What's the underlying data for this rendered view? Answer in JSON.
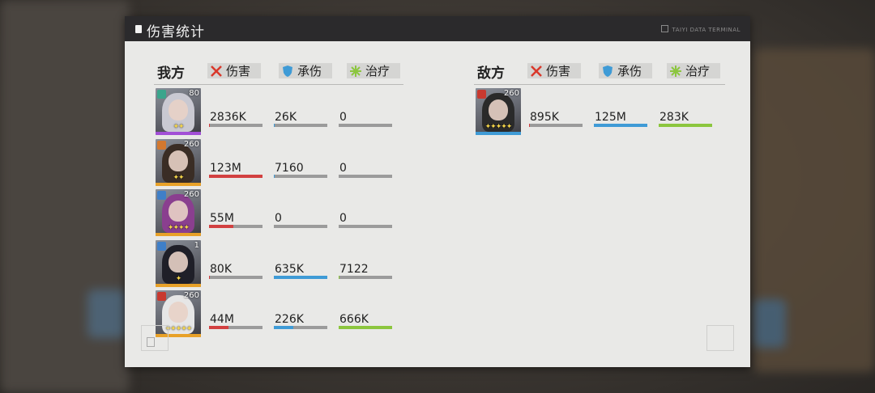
{
  "window": {
    "title": "伤害统计",
    "terminal_label": "TAIYI DATA TERMINAL"
  },
  "colors": {
    "damage": "#d24040",
    "taken": "#3f9bd6",
    "heal": "#8cc63e",
    "track": "#9b9b9b"
  },
  "stat_headers": [
    {
      "label": "伤害",
      "icon": "crossed-swords-icon"
    },
    {
      "label": "承伤",
      "icon": "shield-icon"
    },
    {
      "label": "治疗",
      "icon": "heal-sparkle-icon"
    }
  ],
  "ally": {
    "label": "我方",
    "units": [
      {
        "level": "80",
        "stars": 2,
        "damage": "2836K",
        "damage_ratio": 0.02,
        "taken": "26K",
        "taken_ratio": 0.02,
        "heal": "0",
        "heal_ratio": 0.0,
        "role_icon": "support-icon",
        "rarity_color": "#a24fd6",
        "emblem_color": "#3aa58c",
        "hair": "#c9c9d2"
      },
      {
        "level": "260",
        "stars": 2,
        "damage": "123M",
        "damage_ratio": 1.0,
        "taken": "7160",
        "taken_ratio": 0.01,
        "heal": "0",
        "heal_ratio": 0.0,
        "role_icon": "striker-icon",
        "rarity_color": "#e8a128",
        "emblem_color": "#d3782f",
        "hair": "#3a2d25"
      },
      {
        "level": "260",
        "stars": 4,
        "damage": "55M",
        "damage_ratio": 0.45,
        "taken": "0",
        "taken_ratio": 0.0,
        "heal": "0",
        "heal_ratio": 0.0,
        "role_icon": "guard-icon",
        "rarity_color": "#e8a128",
        "emblem_color": "#3f7fc8",
        "hair": "#8a3f8f"
      },
      {
        "level": "1",
        "stars": 1,
        "damage": "80K",
        "damage_ratio": 0.02,
        "taken": "635K",
        "taken_ratio": 1.0,
        "heal": "7122",
        "heal_ratio": 0.01,
        "role_icon": "guard-icon",
        "rarity_color": "#e8a128",
        "emblem_color": "#3f7fc8",
        "hair": "#1f1f28"
      },
      {
        "level": "260",
        "stars": 5,
        "damage": "44M",
        "damage_ratio": 0.36,
        "taken": "226K",
        "taken_ratio": 0.36,
        "heal": "666K",
        "heal_ratio": 1.0,
        "role_icon": "attacker-icon",
        "rarity_color": "#e8a128",
        "emblem_color": "#c8392f",
        "hair": "#e6e6e6"
      }
    ]
  },
  "enemy": {
    "label": "敌方",
    "units": [
      {
        "level": "260",
        "stars": 5,
        "damage": "895K",
        "damage_ratio": 0.01,
        "taken": "125M",
        "taken_ratio": 1.0,
        "heal": "283K",
        "heal_ratio": 1.0,
        "role_icon": "attacker-icon",
        "rarity_color": "#3f9bd6",
        "emblem_color": "#c8392f",
        "hair": "#2a2a2a"
      }
    ]
  }
}
